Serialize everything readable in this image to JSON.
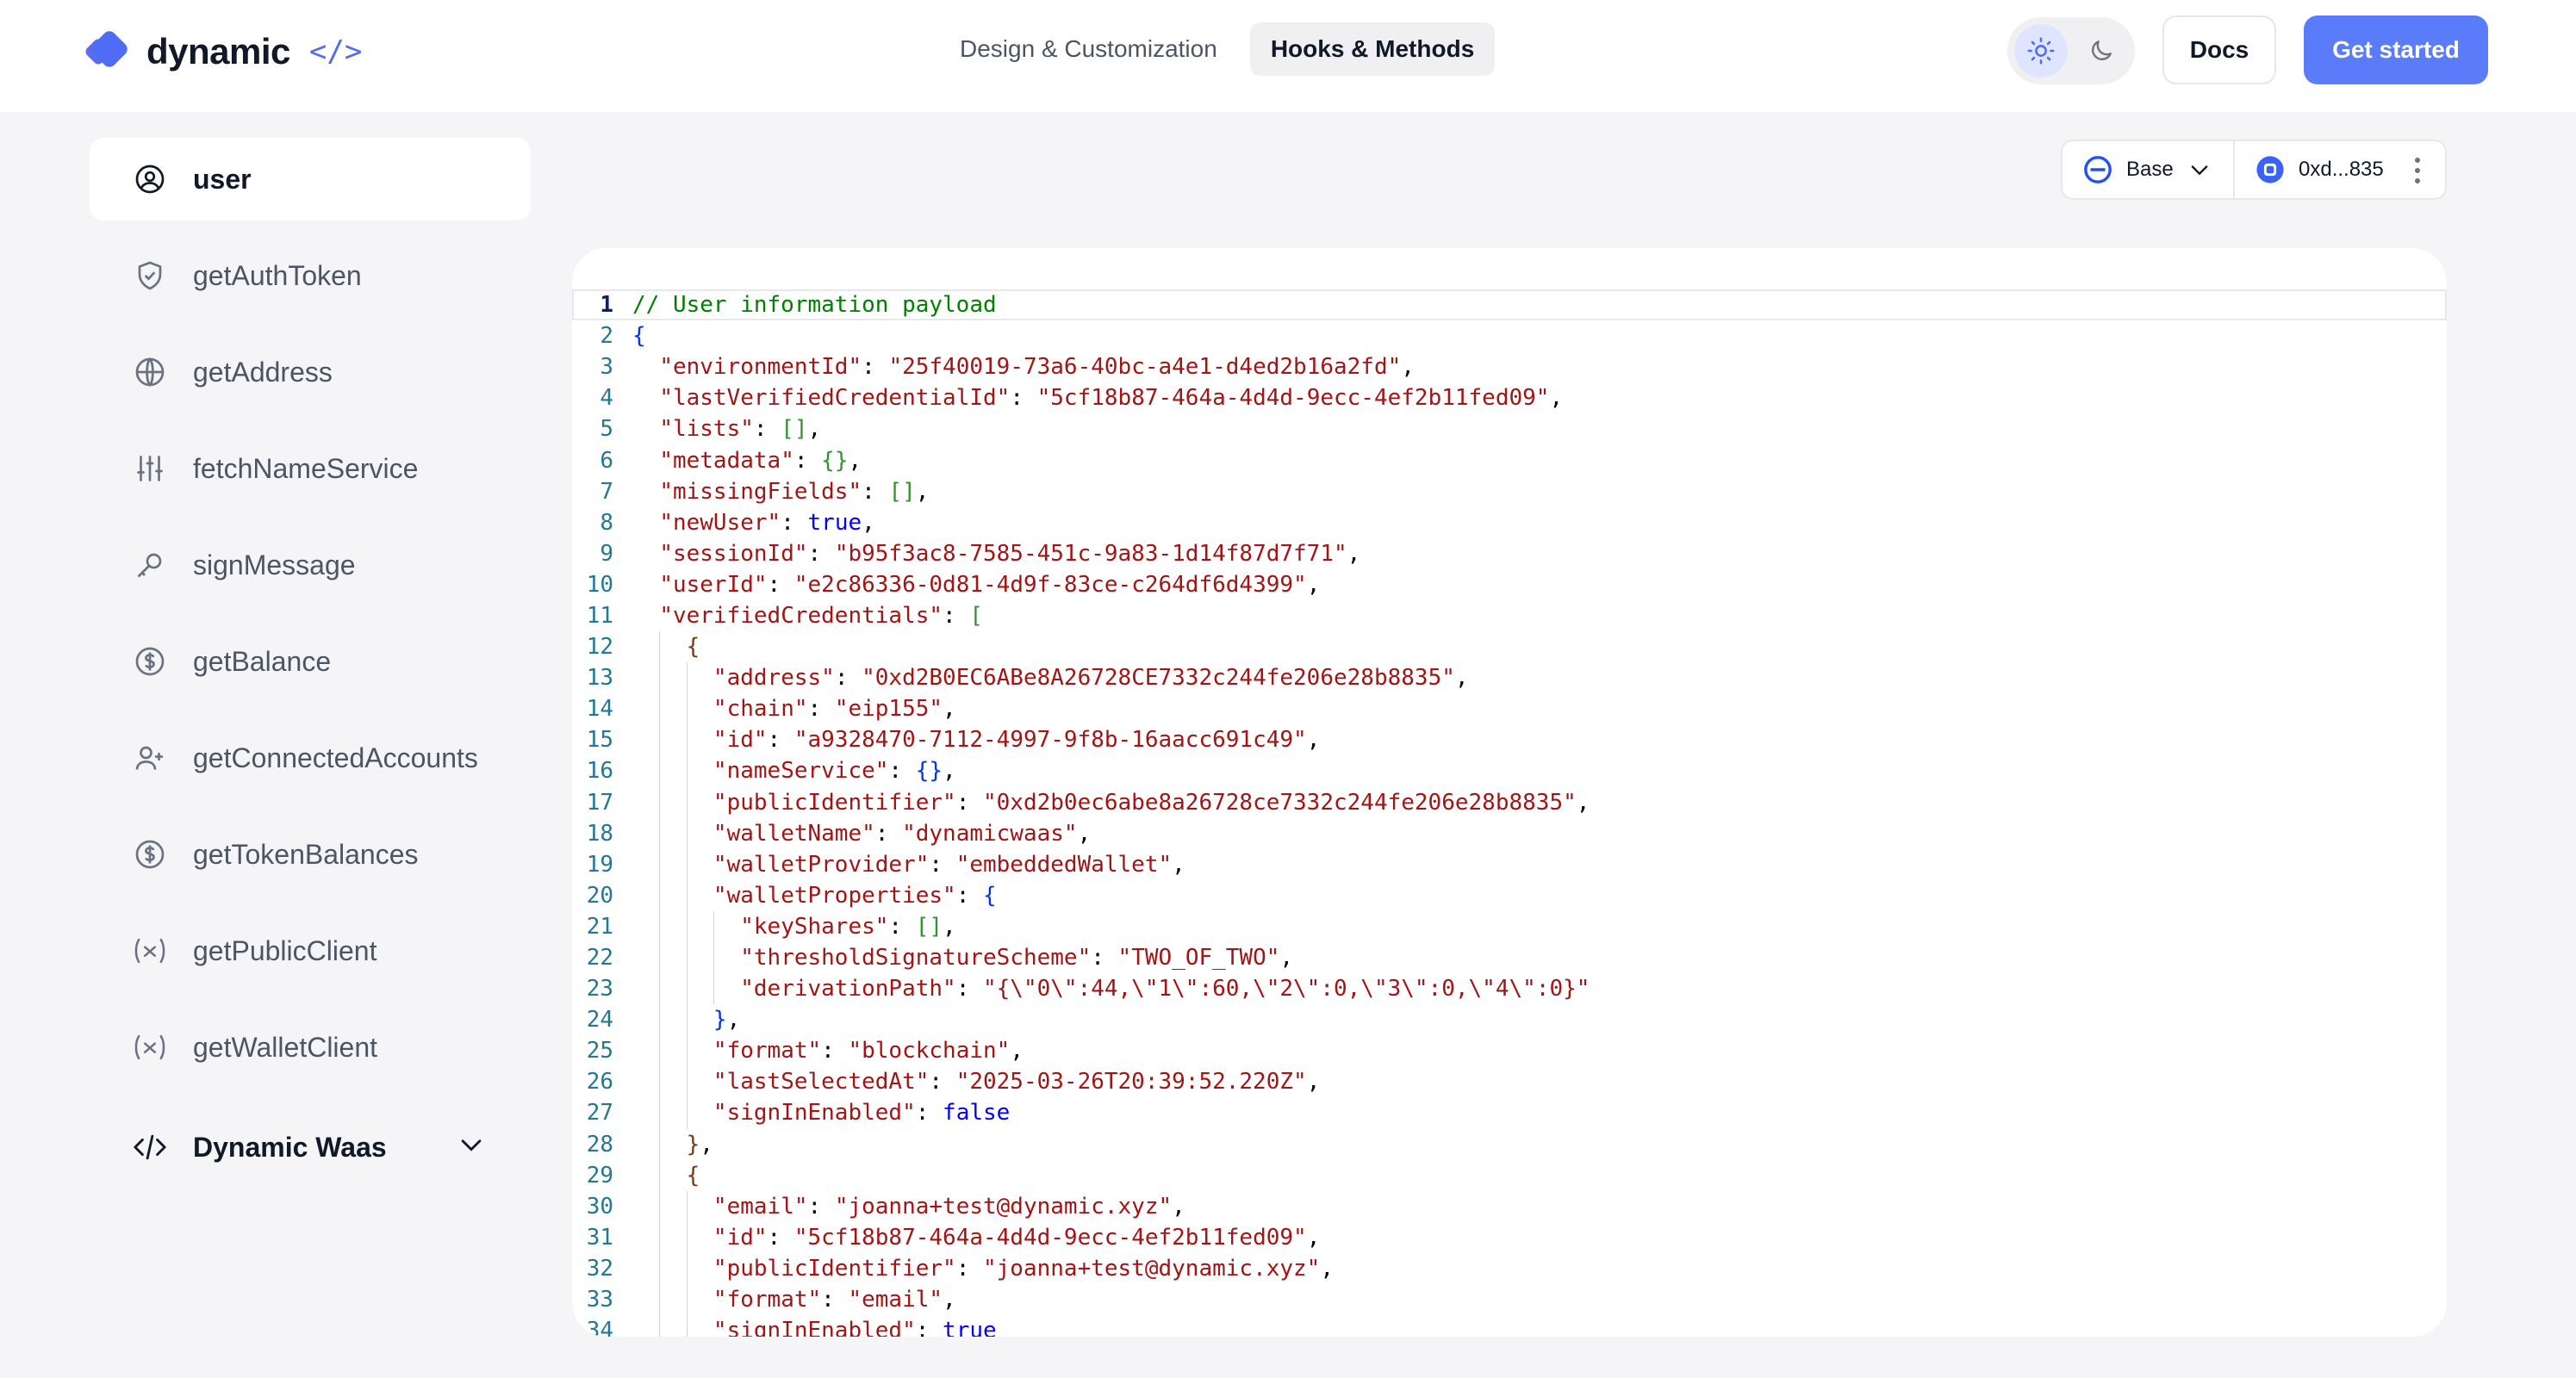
{
  "header": {
    "logo_text": "dynamic",
    "logo_code": "</>",
    "tabs": [
      {
        "label": "Design & Customization"
      },
      {
        "label": "Hooks & Methods"
      }
    ],
    "docs_label": "Docs",
    "cta_label": "Get started"
  },
  "sidebar": {
    "items": [
      {
        "label": "user",
        "icon": "user-circle-icon"
      },
      {
        "label": "getAuthToken",
        "icon": "shield-check-icon"
      },
      {
        "label": "getAddress",
        "icon": "globe-icon"
      },
      {
        "label": "fetchNameService",
        "icon": "sliders-icon"
      },
      {
        "label": "signMessage",
        "icon": "key-icon"
      },
      {
        "label": "getBalance",
        "icon": "dollar-circle-icon"
      },
      {
        "label": "getConnectedAccounts",
        "icon": "user-plus-icon"
      },
      {
        "label": "getTokenBalances",
        "icon": "dollar-circle-icon"
      },
      {
        "label": "getPublicClient",
        "icon": "variable-icon"
      },
      {
        "label": "getWalletClient",
        "icon": "variable-icon"
      }
    ],
    "group": {
      "label": "Dynamic Waas",
      "icon": "code-icon"
    }
  },
  "chain_selector": {
    "network": "Base",
    "wallet": "0xd...835"
  },
  "colors": {
    "accent": "#5b7cfa",
    "comment": "#008000",
    "key": "#a31515",
    "keyword": "#0000ff"
  },
  "code_lines": [
    "// User information payload",
    "{",
    "  \"environmentId\": \"25f40019-73a6-40bc-a4e1-d4ed2b16a2fd\",",
    "  \"lastVerifiedCredentialId\": \"5cf18b87-464a-4d4d-9ecc-4ef2b11fed09\",",
    "  \"lists\": [],",
    "  \"metadata\": {},",
    "  \"missingFields\": [],",
    "  \"newUser\": true,",
    "  \"sessionId\": \"b95f3ac8-7585-451c-9a83-1d14f87d7f71\",",
    "  \"userId\": \"e2c86336-0d81-4d9f-83ce-c264df6d4399\",",
    "  \"verifiedCredentials\": [",
    "    {",
    "      \"address\": \"0xd2B0EC6ABe8A26728CE7332c244fe206e28b8835\",",
    "      \"chain\": \"eip155\",",
    "      \"id\": \"a9328470-7112-4997-9f8b-16aacc691c49\",",
    "      \"nameService\": {},",
    "      \"publicIdentifier\": \"0xd2b0ec6abe8a26728ce7332c244fe206e28b8835\",",
    "      \"walletName\": \"dynamicwaas\",",
    "      \"walletProvider\": \"embeddedWallet\",",
    "      \"walletProperties\": {",
    "        \"keyShares\": [],",
    "        \"thresholdSignatureScheme\": \"TWO_OF_TWO\",",
    "        \"derivationPath\": \"{\\\"0\\\":44,\\\"1\\\":60,\\\"2\\\":0,\\\"3\\\":0,\\\"4\\\":0}\"",
    "      },",
    "      \"format\": \"blockchain\",",
    "      \"lastSelectedAt\": \"2025-03-26T20:39:52.220Z\",",
    "      \"signInEnabled\": false",
    "    },",
    "    {",
    "      \"email\": \"joanna+test@dynamic.xyz\",",
    "      \"id\": \"5cf18b87-464a-4d4d-9ecc-4ef2b11fed09\",",
    "      \"publicIdentifier\": \"joanna+test@dynamic.xyz\",",
    "      \"format\": \"email\",",
    "      \"signInEnabled\": true"
  ]
}
